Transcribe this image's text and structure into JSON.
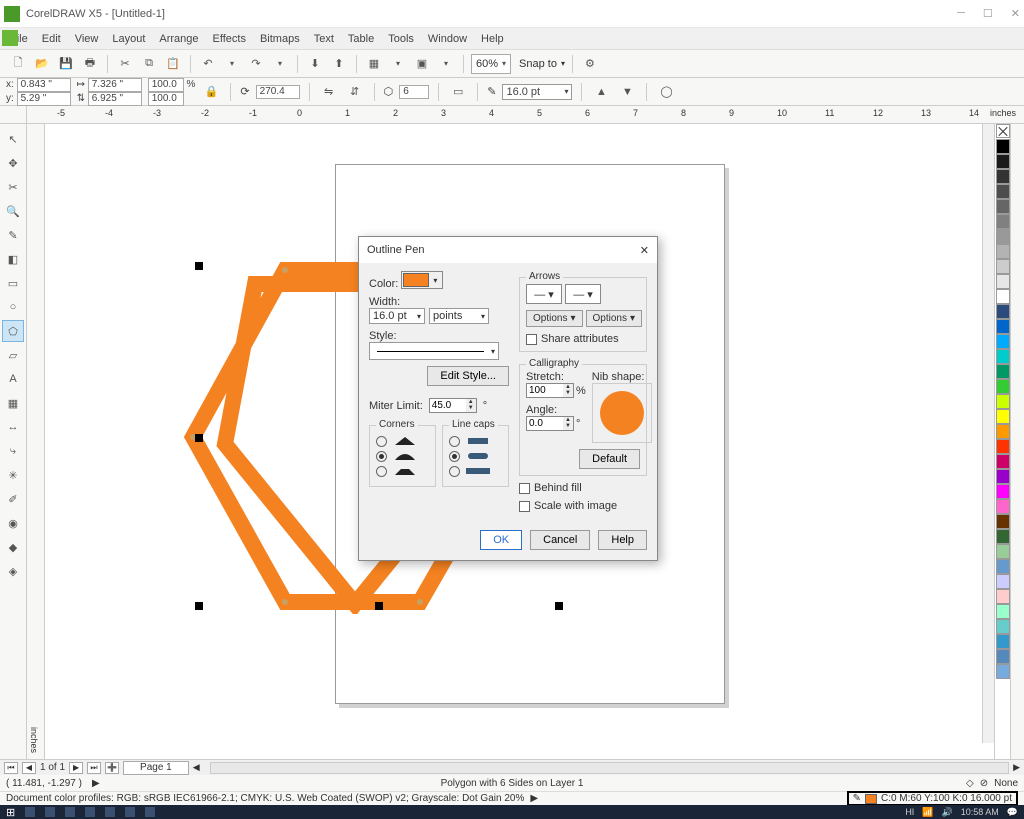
{
  "app": {
    "title": "CorelDRAW X5 - [Untitled-1]"
  },
  "menu": [
    "File",
    "Edit",
    "View",
    "Layout",
    "Arrange",
    "Effects",
    "Bitmaps",
    "Text",
    "Table",
    "Tools",
    "Window",
    "Help"
  ],
  "toolbar": {
    "zoom": "60%",
    "snap_label": "Snap to"
  },
  "props": {
    "x": "0.843 \"",
    "y": "5.29 \"",
    "w": "7.326 \"",
    "h": "6.925 \"",
    "sx": "100.0",
    "sy": "100.0",
    "pct": "%",
    "rot": "270.4",
    "sides": "6",
    "outline_w": "16.0 pt"
  },
  "ruler": {
    "units": "inches",
    "marks": [
      -5,
      -4,
      -3,
      -2,
      -1,
      0,
      1,
      2,
      3,
      4,
      5,
      6,
      7,
      8,
      9,
      10,
      11,
      12,
      13,
      14
    ]
  },
  "dialog": {
    "title": "Outline Pen",
    "color_label": "Color:",
    "width_label": "Width:",
    "width_value": "16.0 pt",
    "width_unit": "points",
    "style_label": "Style:",
    "edit_style": "Edit Style...",
    "miter_label": "Miter Limit:",
    "miter_value": "45.0",
    "corners": "Corners",
    "linecaps": "Line caps",
    "arrows": "Arrows",
    "options": "Options",
    "share_attr": "Share attributes",
    "calligraphy": "Calligraphy",
    "stretch": "Stretch:",
    "stretch_val": "100",
    "angle": "Angle:",
    "angle_val": "0.0",
    "nib": "Nib shape:",
    "default": "Default",
    "behind_fill": "Behind fill",
    "scale_img": "Scale with image",
    "ok": "OK",
    "cancel": "Cancel",
    "help": "Help"
  },
  "palette": [
    "#000000",
    "#1a1a1a",
    "#333333",
    "#4d4d4d",
    "#666666",
    "#808080",
    "#999999",
    "#b3b3b3",
    "#cccccc",
    "#e6e6e6",
    "#ffffff",
    "#2a4b7c",
    "#0066cc",
    "#00aaff",
    "#00cccc",
    "#009966",
    "#33cc33",
    "#ccff00",
    "#ffff00",
    "#ff9900",
    "#ff3300",
    "#cc0066",
    "#9900cc",
    "#ff00ff",
    "#ff66cc",
    "#663300",
    "#336633",
    "#99cc99",
    "#6699cc",
    "#ccccff",
    "#ffcccc",
    "#99ffcc",
    "#66cccc",
    "#3399cc",
    "#5588bb",
    "#77aadd"
  ],
  "pagebar": {
    "pages": "1 of 1",
    "page1": "Page 1"
  },
  "status": {
    "coords": "( 11.481, -1.297 )",
    "object": "Polygon with 6 Sides on Layer 1",
    "fill_none": "None",
    "profiles": "Document color profiles: RGB: sRGB IEC61966-2.1; CMYK: U.S. Web Coated (SWOP) v2; Grayscale: Dot Gain 20%",
    "outline": "C:0 M:60 Y:100 K:0  16.000 pt"
  },
  "tray": {
    "lang": "HI",
    "time": "10:58 AM"
  }
}
